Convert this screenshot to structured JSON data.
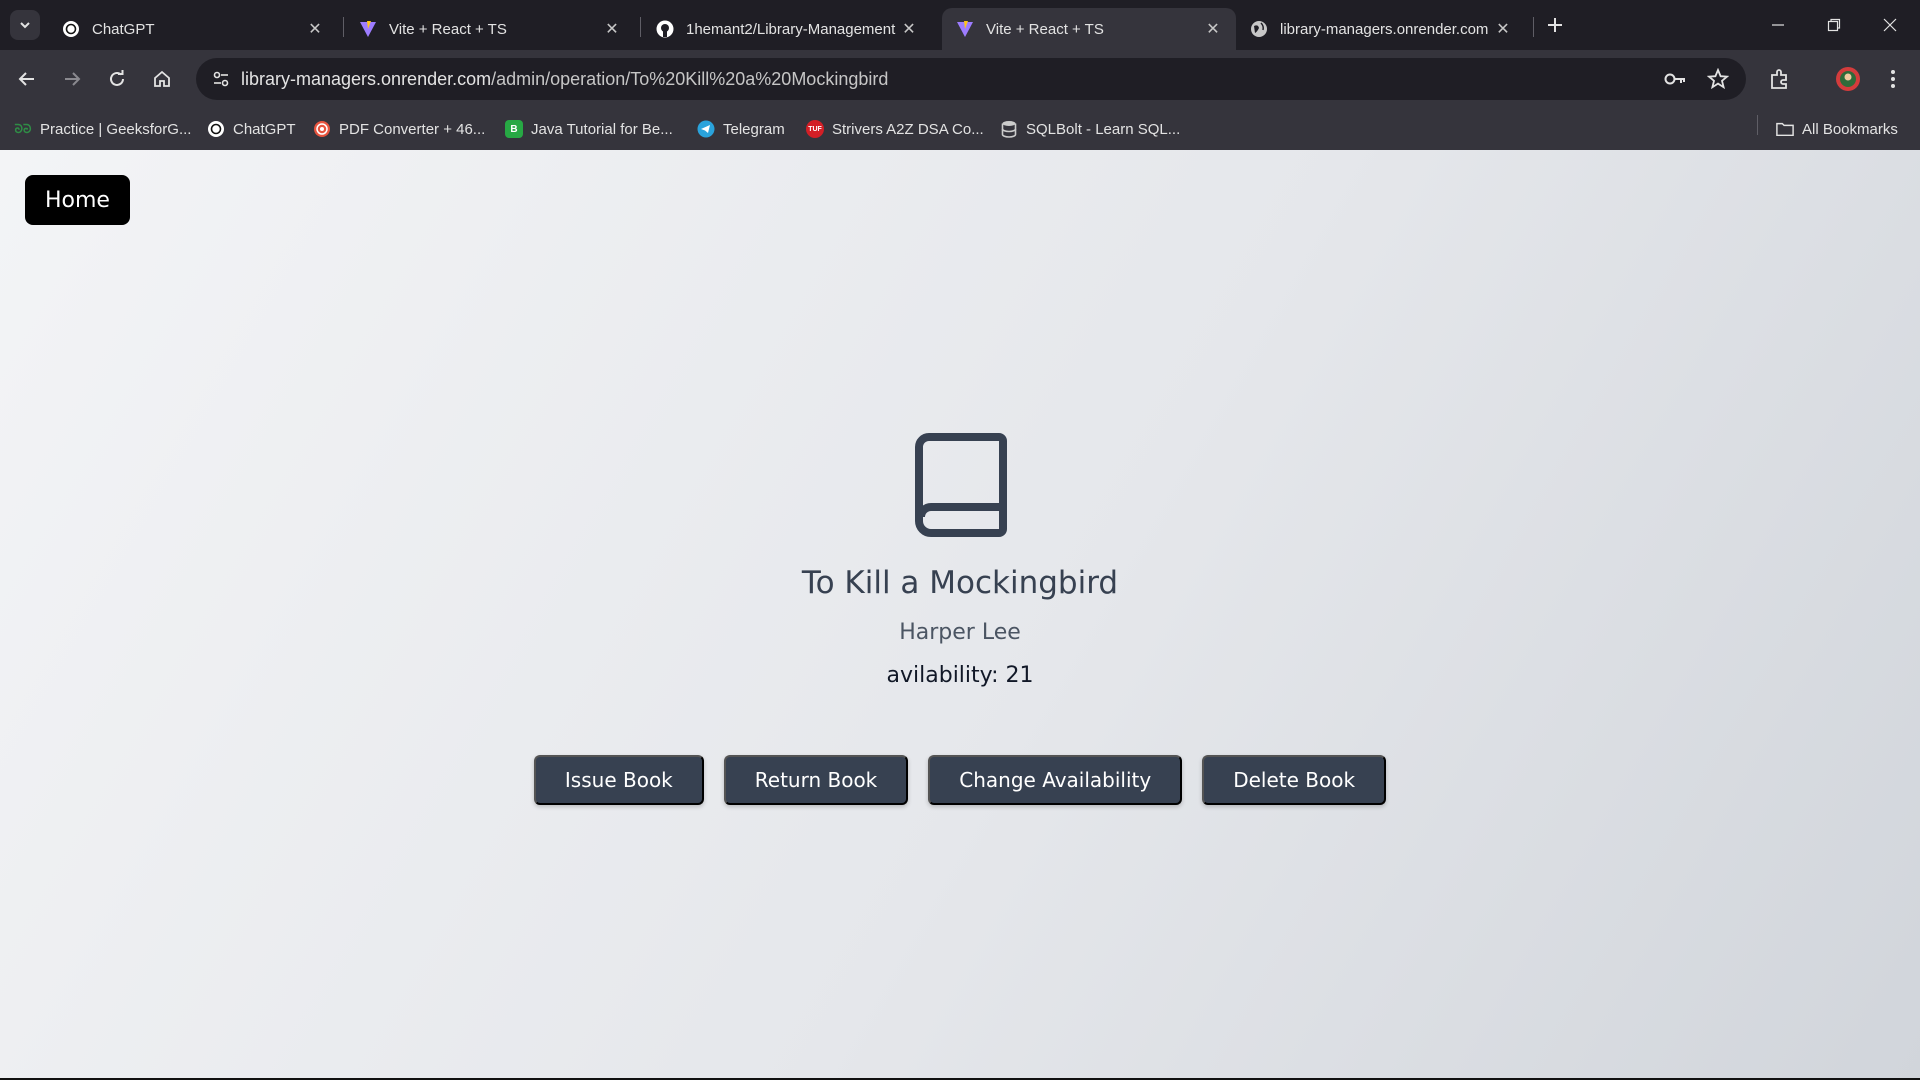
{
  "browser": {
    "tabs": [
      {
        "title": "ChatGPT",
        "icon": "chatgpt-icon"
      },
      {
        "title": "Vite + React + TS",
        "icon": "vite-icon"
      },
      {
        "title": "1hemant2/Library-Management",
        "icon": "github-icon"
      },
      {
        "title": "Vite + React + TS",
        "icon": "vite-icon"
      },
      {
        "title": "library-managers.onrender.com",
        "icon": "globe-icon"
      }
    ],
    "active_tab_index": 3,
    "url_host": "library-managers.onrender.com",
    "url_path": "/admin/operation/To%20Kill%20a%20Mockingbird",
    "bookmarks": [
      {
        "label": "Practice | GeeksforG...",
        "icon": "gfg-icon",
        "color": "#2f8d46"
      },
      {
        "label": "ChatGPT",
        "icon": "chatgpt-icon",
        "color": "#ffffff"
      },
      {
        "label": "PDF Converter + 46...",
        "icon": "pdf-converter-icon",
        "color": "#e8543f"
      },
      {
        "label": "Java Tutorial for Be...",
        "icon": "java-b-icon",
        "color": "#27a844"
      },
      {
        "label": "Telegram",
        "icon": "telegram-icon",
        "color": "#2aa3dc"
      },
      {
        "label": "Strivers A2Z DSA Co...",
        "icon": "tuf-icon",
        "color": "#d31f26"
      },
      {
        "label": "SQLBolt - Learn SQL...",
        "icon": "database-icon",
        "color": "#cccccc"
      }
    ],
    "all_bookmarks_label": "All Bookmarks"
  },
  "page": {
    "home_label": "Home",
    "book": {
      "title": "To Kill a Mockingbird",
      "author": "Harper Lee",
      "availability_text": "avilability: 21"
    },
    "actions": [
      "Issue Book",
      "Return Book",
      "Change Availability",
      "Delete Book"
    ]
  },
  "colors": {
    "button_dark": "#374151",
    "home_button": "#000000",
    "icon_color": "#374151"
  }
}
